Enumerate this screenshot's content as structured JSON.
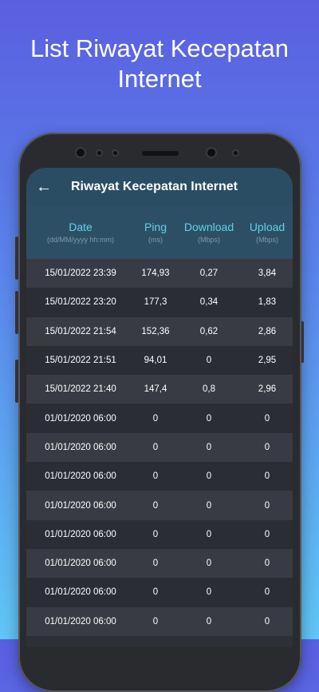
{
  "promo": {
    "title": "List Riwayat Kecepatan Internet"
  },
  "appbar": {
    "back_icon": "arrow-left-icon",
    "title": "Riwayat Kecepatan Internet"
  },
  "columns": [
    {
      "title": "Date",
      "sub": "(dd/MM/yyyy hh:mm)"
    },
    {
      "title": "Ping",
      "sub": "(ms)"
    },
    {
      "title": "Download",
      "sub": "(Mbps)"
    },
    {
      "title": "Upload",
      "sub": "(Mbps)"
    }
  ],
  "rows": [
    [
      "15/01/2022 23:39",
      "174,93",
      "0,27",
      "3,84"
    ],
    [
      "15/01/2022 23:20",
      "177,3",
      "0,34",
      "1,83"
    ],
    [
      "15/01/2022 21:54",
      "152,36",
      "0,62",
      "2,86"
    ],
    [
      "15/01/2022 21:51",
      "94,01",
      "0",
      "2,95"
    ],
    [
      "15/01/2022 21:40",
      "147,4",
      "0,8",
      "2,96"
    ],
    [
      "01/01/2020 06:00",
      "0",
      "0",
      "0"
    ],
    [
      "01/01/2020 06:00",
      "0",
      "0",
      "0"
    ],
    [
      "01/01/2020 06:00",
      "0",
      "0",
      "0"
    ],
    [
      "01/01/2020 06:00",
      "0",
      "0",
      "0"
    ],
    [
      "01/01/2020 06:00",
      "0",
      "0",
      "0"
    ],
    [
      "01/01/2020 06:00",
      "0",
      "0",
      "0"
    ],
    [
      "01/01/2020 06:00",
      "0",
      "0",
      "0"
    ],
    [
      "01/01/2020 06:00",
      "0",
      "0",
      "0"
    ]
  ],
  "colors": {
    "background_top": "#5a5fe0",
    "background_bottom": "#5fc6f5",
    "appbar": "#2b4d64",
    "header_text": "#5ed3e6",
    "row_odd": "#393b44",
    "row_even": "#2b2d35"
  }
}
